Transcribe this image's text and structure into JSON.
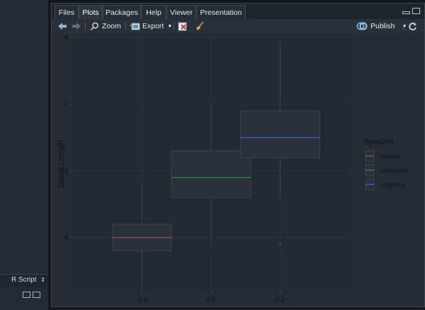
{
  "left_pane": {
    "script_type_label": "R Script",
    "script_type_chevron": "⌃"
  },
  "tabs": [
    "Files",
    "Plots",
    "Packages",
    "Help",
    "Viewer",
    "Presentation"
  ],
  "active_tab": "Plots",
  "toolbar": {
    "zoom_label": "Zoom",
    "export_label": "Export",
    "publish_label": "Publish"
  },
  "chart_data": {
    "type": "boxplot",
    "title": "",
    "xlabel": "",
    "ylabel": "Sepal.Length",
    "x_ticks": [
      "-0.2",
      "0.0",
      "0.2"
    ],
    "y_ticks": [
      "5",
      "6",
      "7",
      "8"
    ],
    "ylim": [
      4.2,
      8.0
    ],
    "xlim": [
      -0.4,
      0.4
    ],
    "legend_title": "Species",
    "legend_position": "right",
    "series": [
      {
        "name": "setosa",
        "color": "#8a4a52",
        "x_center": -0.2,
        "box_width": 0.17,
        "min": 4.3,
        "q1": 4.8,
        "median": 5.0,
        "q3": 5.2,
        "max": 5.8,
        "outliers": []
      },
      {
        "name": "versicolor",
        "color": "#2f7a45",
        "x_center": 0.0,
        "box_width": 0.23,
        "min": 4.9,
        "q1": 5.6,
        "median": 5.9,
        "q3": 6.3,
        "max": 7.0,
        "outliers": []
      },
      {
        "name": "virginica",
        "color": "#3a5cb8",
        "x_center": 0.2,
        "box_width": 0.23,
        "min": 5.6,
        "q1": 6.2,
        "median": 6.5,
        "q3": 6.9,
        "max": 7.9,
        "outliers": [
          4.9
        ]
      }
    ],
    "grid": true
  }
}
